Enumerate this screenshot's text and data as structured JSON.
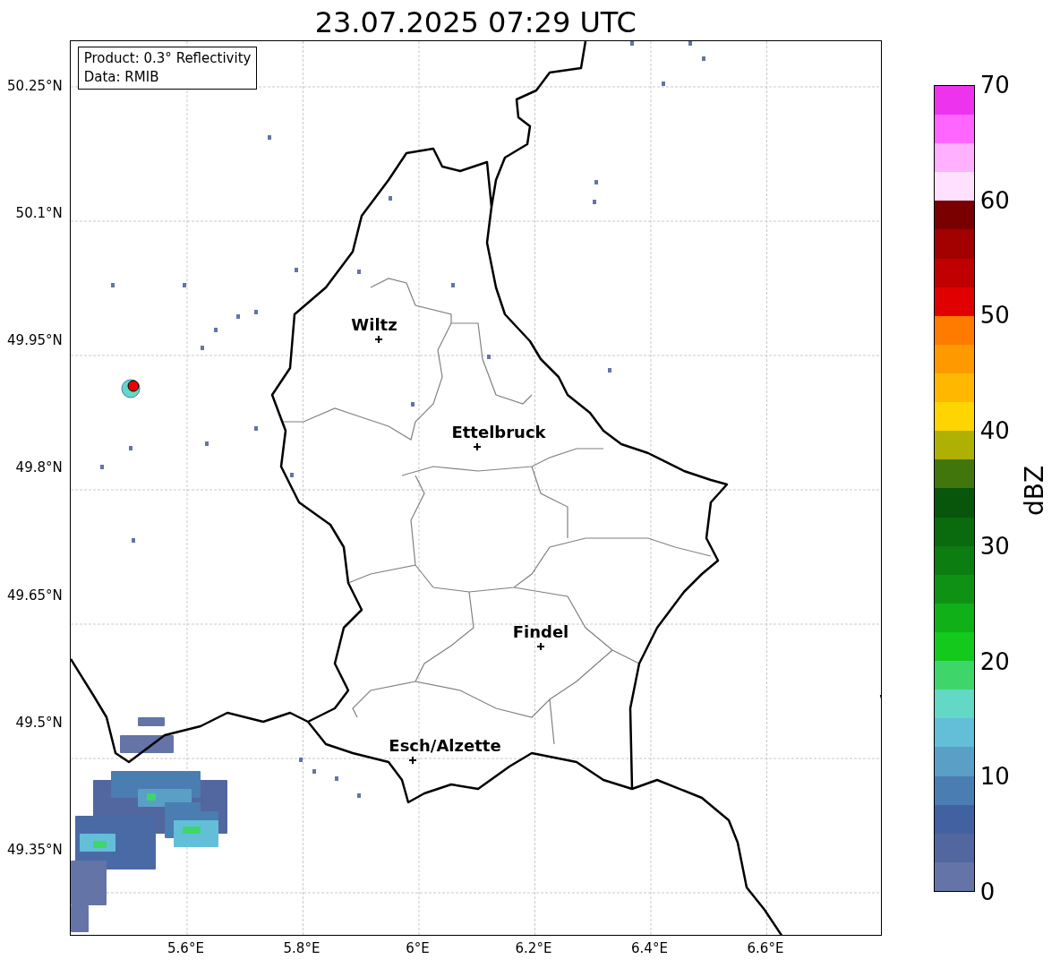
{
  "title": "23.07.2025 07:29 UTC",
  "info_box": [
    "Product: 0.3° Reflectivity",
    "Data: RMIB"
  ],
  "map": {
    "cities": [
      {
        "name": "Wiltz"
      },
      {
        "name": "Ettelbruck"
      },
      {
        "name": "Findel"
      },
      {
        "name": "Esch/Alzette"
      }
    ],
    "lat_ticks": [
      "50.25°N",
      "50.1°N",
      "49.95°N",
      "49.8°N",
      "49.65°N",
      "49.5°N",
      "49.35°N"
    ],
    "lon_ticks": [
      "5.6°E",
      "5.8°E",
      "6°E",
      "6.2°E",
      "6.4°E",
      "6.6°E"
    ]
  },
  "colorbar": {
    "label": "dBZ",
    "ticks": [
      "70",
      "60",
      "50",
      "40",
      "30",
      "20",
      "10",
      "0"
    ],
    "segments": [
      {
        "color": "#6474a6"
      },
      {
        "color": "#52679f"
      },
      {
        "color": "#4261a0"
      },
      {
        "color": "#4a7db2"
      },
      {
        "color": "#5a9fc6"
      },
      {
        "color": "#63bfd8"
      },
      {
        "color": "#63d8c4"
      },
      {
        "color": "#3ed66b"
      },
      {
        "color": "#12c91c"
      },
      {
        "color": "#10b018"
      },
      {
        "color": "#0e9214"
      },
      {
        "color": "#0c7d11"
      },
      {
        "color": "#0a6a0e"
      },
      {
        "color": "#08560b"
      },
      {
        "color": "#41760c"
      },
      {
        "color": "#aeb004"
      },
      {
        "color": "#ffd500"
      },
      {
        "color": "#ffb700"
      },
      {
        "color": "#ff9900"
      },
      {
        "color": "#ff7b00"
      },
      {
        "color": "#e00000"
      },
      {
        "color": "#c00000"
      },
      {
        "color": "#a30000"
      },
      {
        "color": "#7a0000"
      },
      {
        "color": "#ffe0ff"
      },
      {
        "color": "#ffb0ff"
      },
      {
        "color": "#ff66ff"
      },
      {
        "color": "#ee33ee"
      }
    ]
  }
}
